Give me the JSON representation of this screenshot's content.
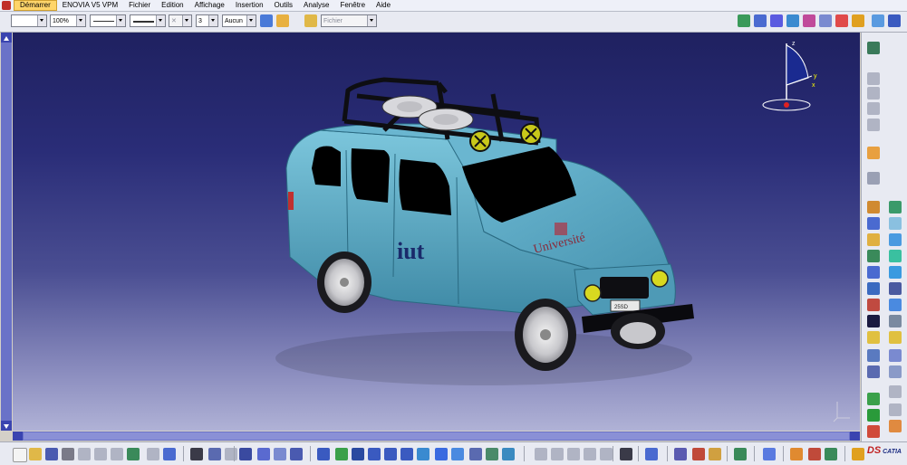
{
  "menu": {
    "items": [
      "Démarrer",
      "ENOVIA V5 VPM",
      "Fichier",
      "Edition",
      "Affichage",
      "Insertion",
      "Outils",
      "Analyse",
      "Fenêtre",
      "Aide"
    ]
  },
  "properties": {
    "zoom": "100%",
    "thickness": "3",
    "layer": "Aucun",
    "filter": "Fichier"
  },
  "viewport": {
    "compass_axes": {
      "z": "z",
      "y": "y",
      "x": "x"
    },
    "door_logo": "iut",
    "hood_text": "Université",
    "plate_text": "25SD"
  },
  "brand": "CATIA",
  "colors": {
    "car_body": "#5aa9c4",
    "background_top": "#1f2160",
    "background_bottom": "#b0b2d6",
    "active_menu": "#ffd56a"
  }
}
